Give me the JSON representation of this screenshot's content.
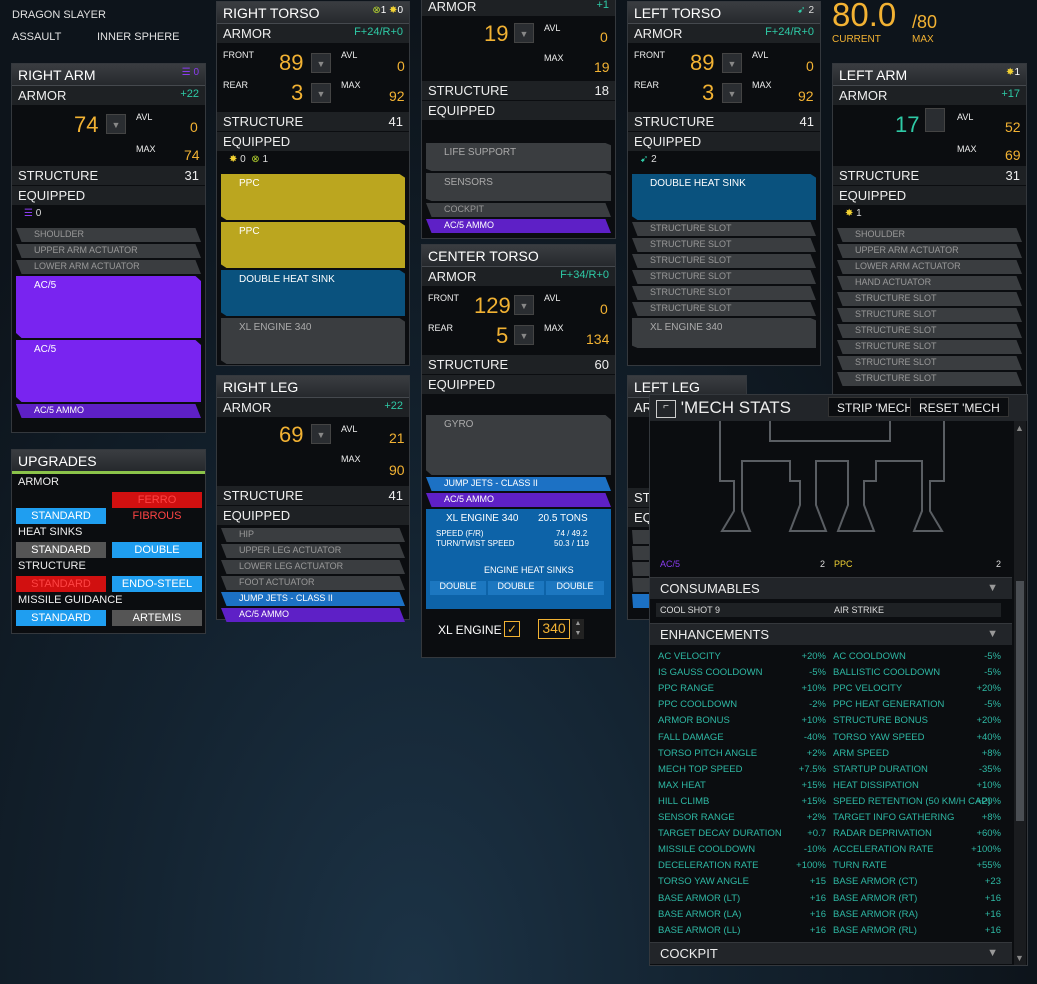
{
  "header": {
    "mech_name": "DRAGON SLAYER",
    "class": "ASSAULT",
    "faction": "INNER SPHERE"
  },
  "tonnage": {
    "value": "80.0",
    "max": "/80",
    "current_label": "CURRENT",
    "max_label": "MAX"
  },
  "right_arm": {
    "title": "RIGHT ARM",
    "icon_count": "0",
    "armor_label": "ARMOR",
    "armor_bonus": "+22",
    "front": "74",
    "avl_label": "AVL",
    "avl": "0",
    "max_label": "MAX",
    "max": "74",
    "structure_label": "STRUCTURE",
    "structure": "31",
    "equipped_label": "EQUIPPED",
    "eq_count": "0",
    "slots": [
      "SHOULDER",
      "UPPER ARM ACTUATOR",
      "LOWER ARM ACTUATOR"
    ],
    "weapons": [
      "AC/5",
      "AC/5"
    ],
    "ammo": "AC/5 AMMO"
  },
  "right_torso": {
    "title": "RIGHT TORSO",
    "icon1": "1",
    "icon2": "0",
    "armor_label": "ARMOR",
    "armor_bonus": "F+24/R+0",
    "front_label": "FRONT",
    "front": "89",
    "avl_label": "AVL",
    "avl": "0",
    "rear_label": "REAR",
    "rear": "3",
    "max_label": "MAX",
    "max": "92",
    "structure_label": "STRUCTURE",
    "structure": "41",
    "equipped_label": "EQUIPPED",
    "eq1": "0",
    "eq2": "1",
    "items": [
      "PPC",
      "PPC",
      "DOUBLE HEAT SINK",
      "XL ENGINE 340"
    ]
  },
  "head": {
    "armor_label": "ARMOR",
    "armor_bonus": "+1",
    "front": "19",
    "avl_label": "AVL",
    "avl": "0",
    "max_label": "MAX",
    "max": "19",
    "structure_label": "STRUCTURE",
    "structure": "18",
    "equipped_label": "EQUIPPED",
    "slots": [
      "LIFE SUPPORT",
      "SENSORS",
      "COCKPIT"
    ],
    "ammo": "AC/5 AMMO"
  },
  "center_torso": {
    "title": "CENTER TORSO",
    "armor_label": "ARMOR",
    "armor_bonus": "F+34/R+0",
    "front_label": "FRONT",
    "front": "129",
    "avl_label": "AVL",
    "avl": "0",
    "rear_label": "REAR",
    "rear": "5",
    "max_label": "MAX",
    "max": "134",
    "structure_label": "STRUCTURE",
    "structure": "60",
    "equipped_label": "EQUIPPED",
    "gyro": "GYRO",
    "jump": "JUMP JETS - CLASS II",
    "ammo": "AC/5 AMMO",
    "engine": "XL ENGINE 340",
    "engine_tons": "20.5 TONS",
    "speed_label": "SPEED (F/R)",
    "speed": "74 / 49.2",
    "turn_label": "TURN/TWIST SPEED",
    "turn": "50.3 / 119",
    "ehs_label": "ENGINE HEAT SINKS",
    "ehs": [
      "DOUBLE",
      "DOUBLE",
      "DOUBLE"
    ],
    "xl_label": "XL ENGINE",
    "engine_rating": "340"
  },
  "left_torso": {
    "title": "LEFT TORSO",
    "icon_count": "2",
    "armor_label": "ARMOR",
    "armor_bonus": "F+24/R+0",
    "front_label": "FRONT",
    "front": "89",
    "avl_label": "AVL",
    "avl": "0",
    "rear_label": "REAR",
    "rear": "3",
    "max_label": "MAX",
    "max": "92",
    "structure_label": "STRUCTURE",
    "structure": "41",
    "equipped_label": "EQUIPPED",
    "eq_count": "2",
    "heatsink": "DOUBLE HEAT SINK",
    "slots": [
      "STRUCTURE SLOT",
      "STRUCTURE SLOT",
      "STRUCTURE SLOT",
      "STRUCTURE SLOT",
      "STRUCTURE SLOT",
      "STRUCTURE SLOT"
    ],
    "engine": "XL ENGINE 340"
  },
  "left_arm": {
    "title": "LEFT ARM",
    "icon_count": "1",
    "armor_label": "ARMOR",
    "armor_bonus": "+17",
    "front": "17",
    "avl_label": "AVL",
    "avl": "52",
    "max_label": "MAX",
    "max": "69",
    "structure_label": "STRUCTURE",
    "structure": "31",
    "equipped_label": "EQUIPPED",
    "eq_count": "1",
    "slots": [
      "SHOULDER",
      "UPPER ARM ACTUATOR",
      "LOWER ARM ACTUATOR",
      "HAND ACTUATOR",
      "STRUCTURE SLOT",
      "STRUCTURE SLOT",
      "STRUCTURE SLOT",
      "STRUCTURE SLOT",
      "STRUCTURE SLOT",
      "STRUCTURE SLOT"
    ]
  },
  "right_leg": {
    "title": "RIGHT LEG",
    "armor_label": "ARMOR",
    "armor_bonus": "+22",
    "front": "69",
    "avl_label": "AVL",
    "avl": "21",
    "max_label": "MAX",
    "max": "90",
    "structure_label": "STRUCTURE",
    "structure": "41",
    "equipped_label": "EQUIPPED",
    "slots": [
      "HIP",
      "UPPER LEG ACTUATOR",
      "LOWER LEG ACTUATOR",
      "FOOT ACTUATOR"
    ],
    "jump": "JUMP JETS - CLASS II",
    "ammo": "AC/5 AMMO"
  },
  "left_leg": {
    "title": "LEFT LEG",
    "armor_partial": "AR",
    "structure_partial": "STI",
    "equipped_partial": "EQ"
  },
  "upgrades": {
    "title": "UPGRADES",
    "armor_label": "ARMOR",
    "armor_opts": [
      "STANDARD",
      "FERRO FIBROUS"
    ],
    "hs_label": "HEAT SINKS",
    "hs_opts": [
      "STANDARD",
      "DOUBLE"
    ],
    "struct_label": "STRUCTURE",
    "struct_opts": [
      "STANDARD",
      "ENDO-STEEL"
    ],
    "mg_label": "MISSILE GUIDANCE",
    "mg_opts": [
      "STANDARD",
      "ARTEMIS"
    ]
  },
  "stats": {
    "title": "'MECH STATS",
    "strip": "STRIP 'MECH",
    "reset": "RESET 'MECH",
    "weapons": [
      {
        "name": "AC/5",
        "count": "2"
      },
      {
        "name": "PPC",
        "count": "2"
      }
    ],
    "consumables_label": "CONSUMABLES",
    "consumables": [
      "COOL SHOT 9",
      "AIR STRIKE"
    ],
    "enhancements_label": "ENHANCEMENTS",
    "enhancements": [
      [
        "AC VELOCITY",
        "+20%",
        "AC COOLDOWN",
        "-5%"
      ],
      [
        "IS GAUSS COOLDOWN",
        "-5%",
        "BALLISTIC COOLDOWN",
        "-5%"
      ],
      [
        "PPC RANGE",
        "+10%",
        "PPC VELOCITY",
        "+20%"
      ],
      [
        "PPC COOLDOWN",
        "-2%",
        "PPC HEAT GENERATION",
        "-5%"
      ],
      [
        "ARMOR BONUS",
        "+10%",
        "STRUCTURE BONUS",
        "+20%"
      ],
      [
        "FALL DAMAGE",
        "-40%",
        "TORSO YAW SPEED",
        "+40%"
      ],
      [
        "TORSO PITCH ANGLE",
        "+2%",
        "ARM SPEED",
        "+8%"
      ],
      [
        "MECH TOP SPEED",
        "+7.5%",
        "STARTUP DURATION",
        "-35%"
      ],
      [
        "MAX HEAT",
        "+15%",
        "HEAT DISSIPATION",
        "+10%"
      ],
      [
        "HILL CLIMB",
        "+15%",
        "SPEED RETENTION (50 KM/H CAP)",
        "+20%"
      ],
      [
        "SENSOR RANGE",
        "+2%",
        "TARGET INFO GATHERING",
        "+8%"
      ],
      [
        "TARGET DECAY DURATION",
        "+0.7",
        "RADAR DEPRIVATION",
        "+60%"
      ],
      [
        "MISSILE COOLDOWN",
        "-10%",
        "ACCELERATION RATE",
        "+100%"
      ],
      [
        "DECELERATION RATE",
        "+100%",
        "TURN RATE",
        "+55%"
      ],
      [
        "TORSO YAW ANGLE",
        "+15",
        "BASE ARMOR (CT)",
        "+23"
      ],
      [
        "BASE ARMOR (LT)",
        "+16",
        "BASE ARMOR (RT)",
        "+16"
      ],
      [
        "BASE ARMOR (LA)",
        "+16",
        "BASE ARMOR (RA)",
        "+16"
      ],
      [
        "BASE ARMOR (LL)",
        "+16",
        "BASE ARMOR (RL)",
        "+16"
      ]
    ],
    "cockpit_label": "COCKPIT"
  }
}
